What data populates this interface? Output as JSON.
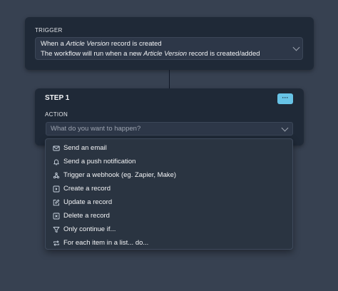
{
  "trigger": {
    "label": "TRIGGER",
    "line1_prefix": "When a ",
    "line1_entity": "Article Version",
    "line1_suffix": " record is created",
    "line2_prefix": "The workflow will run when a new ",
    "line2_entity": "Article Version",
    "line2_suffix": " record is created/added",
    "chevron_icon": "chevron-down-icon"
  },
  "step": {
    "title": "STEP 1",
    "more_button_label": "···",
    "action_label": "ACTION",
    "action_placeholder": "What do you want to happen?",
    "accent_color": "#67c3e6"
  },
  "menu": {
    "items": [
      {
        "label": "Send an email",
        "icon": "mail-icon"
      },
      {
        "label": "Send a push notification",
        "icon": "bell-icon"
      },
      {
        "label": "Trigger a webhook (eg. Zapier, Make)",
        "icon": "webhook-icon"
      },
      {
        "label": "Create a record",
        "icon": "create-record-icon"
      },
      {
        "label": "Update a record",
        "icon": "edit-icon"
      },
      {
        "label": "Delete a record",
        "icon": "delete-record-icon"
      },
      {
        "label": "Only continue if...",
        "icon": "filter-icon"
      },
      {
        "label": "For each item in a list... do...",
        "icon": "repeat-icon"
      }
    ]
  }
}
